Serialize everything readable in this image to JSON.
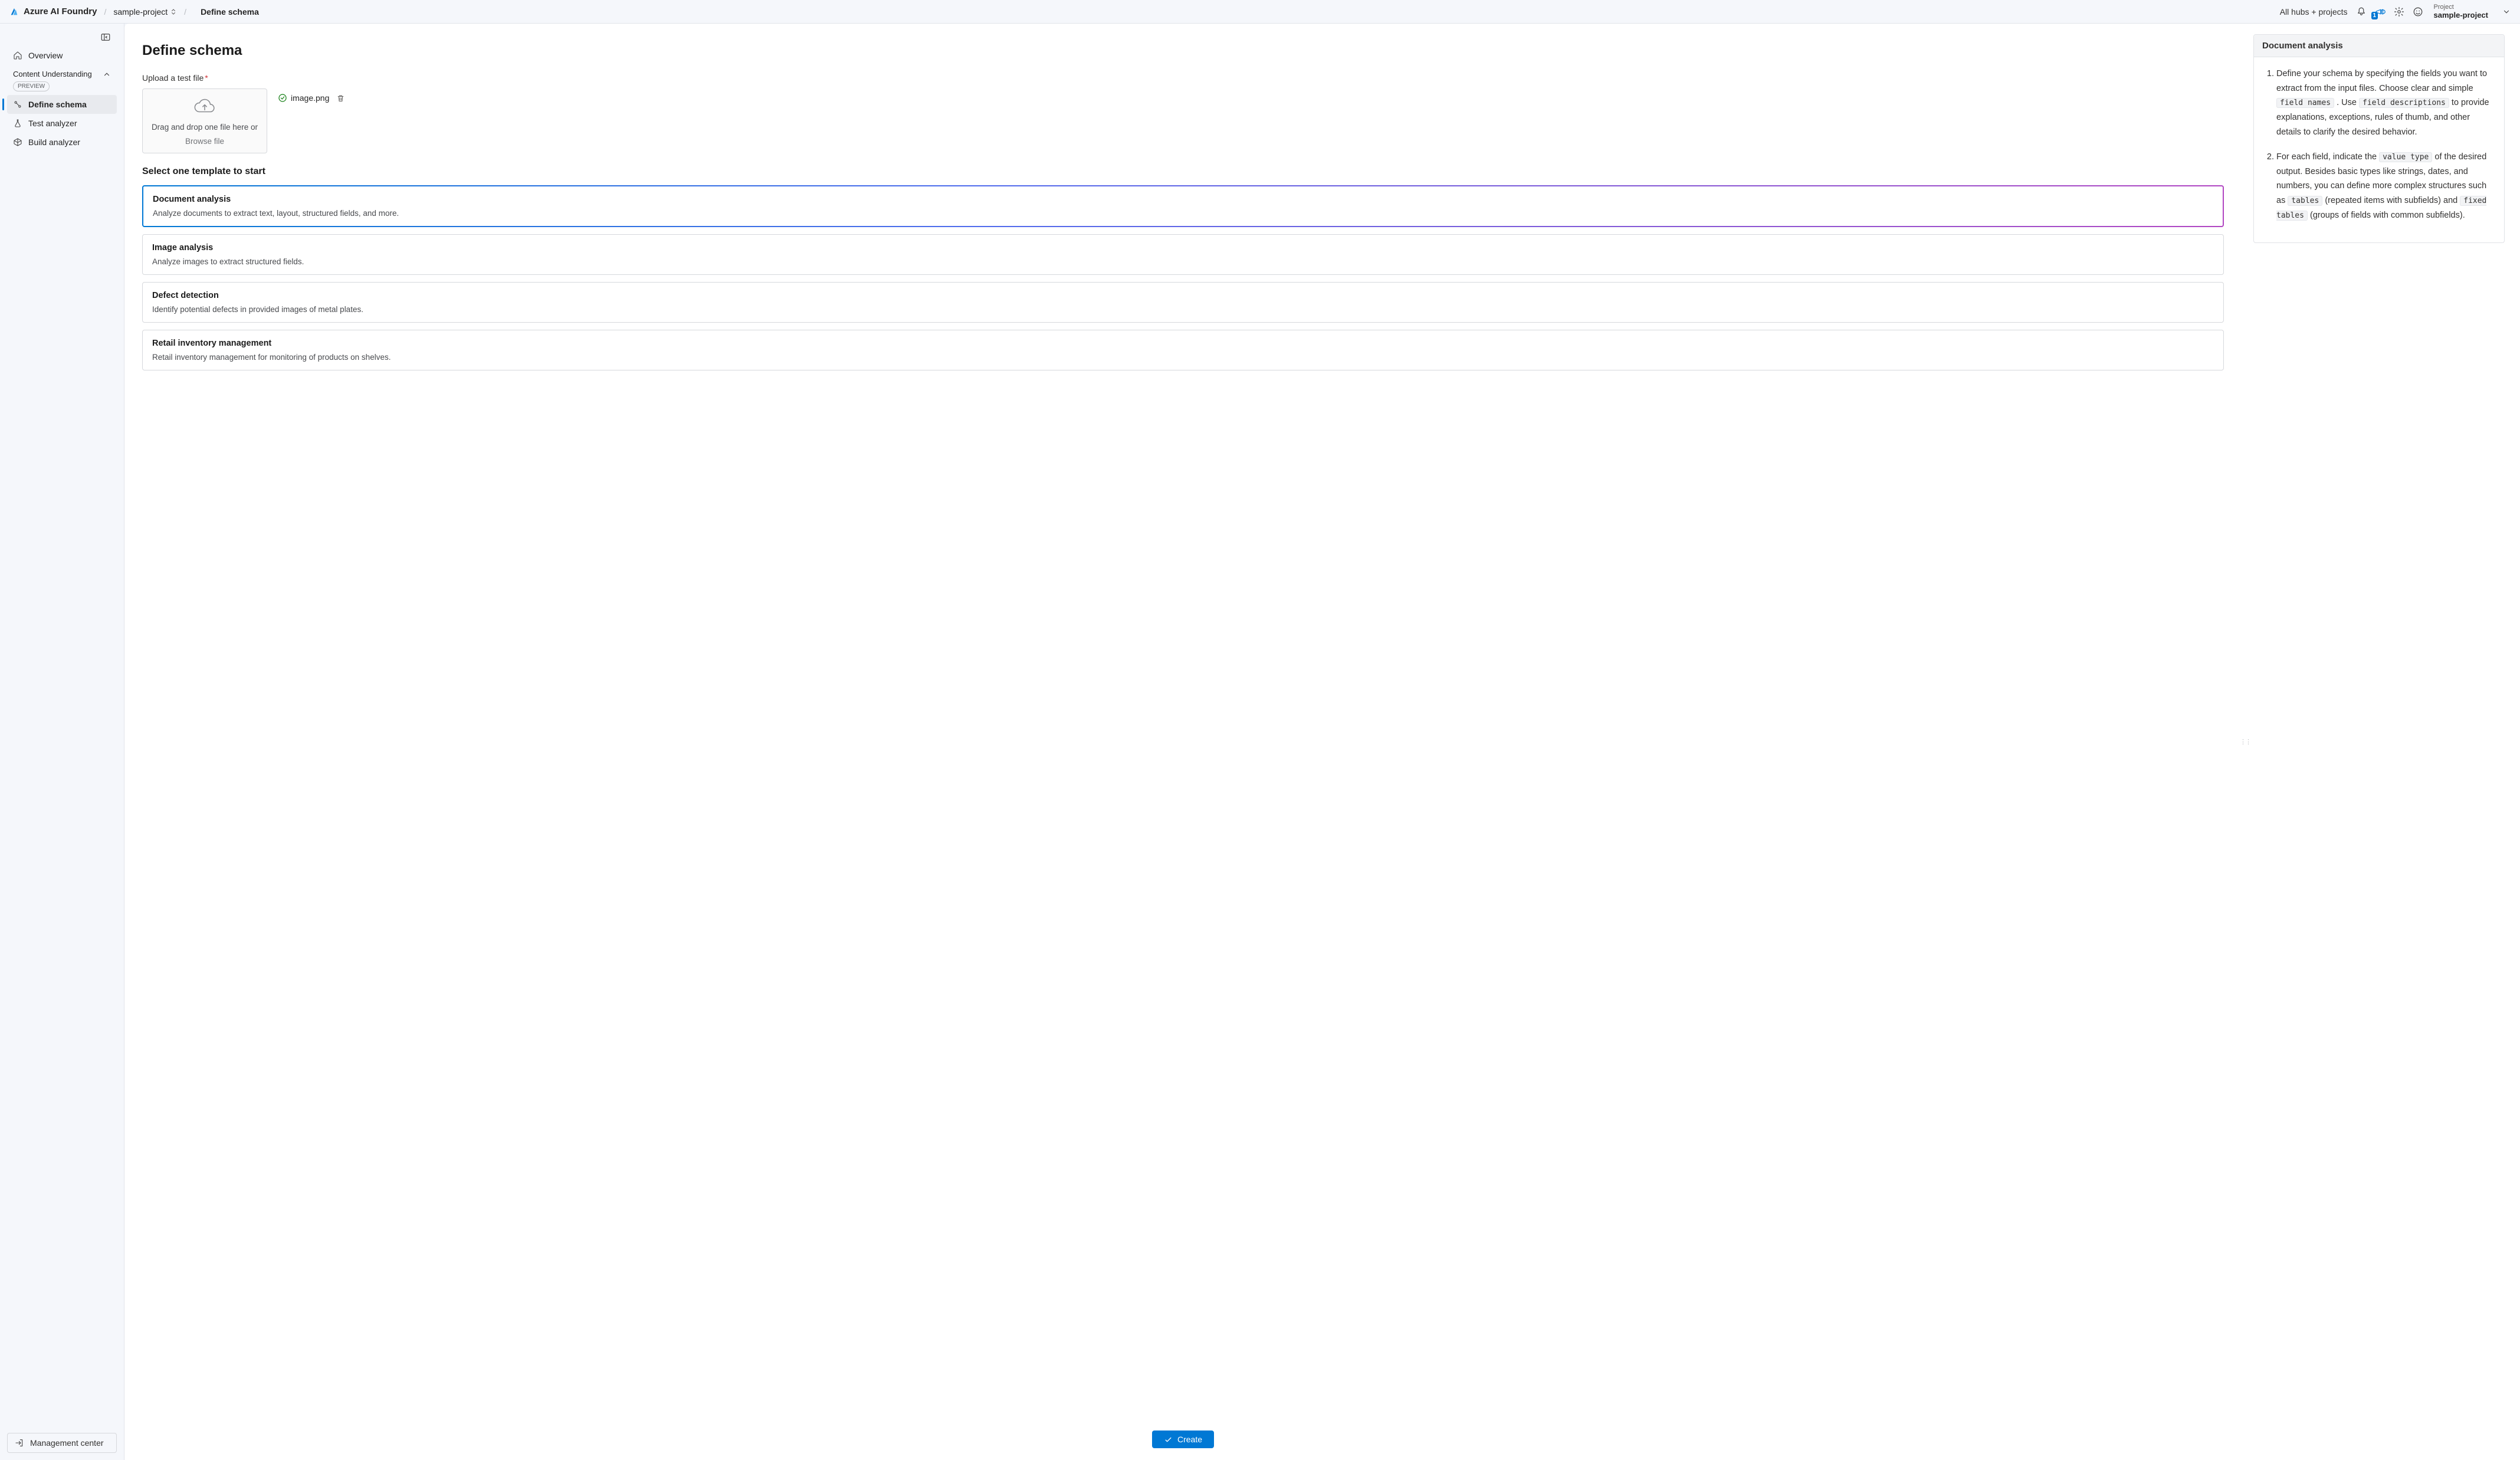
{
  "brand": "Azure AI Foundry",
  "breadcrumb": {
    "project": "sample-project",
    "current": "Define schema"
  },
  "topbar": {
    "hubs_link": "All hubs + projects",
    "announce_badge": "1",
    "project_label": "Project",
    "project_value": "sample-project"
  },
  "sidebar": {
    "overview": "Overview",
    "group_title": "Content Understanding",
    "preview_tag": "PREVIEW",
    "define_schema": "Define schema",
    "test_analyzer": "Test analyzer",
    "build_analyzer": "Build analyzer",
    "mgmt_center": "Management center"
  },
  "page": {
    "title": "Define schema",
    "upload_label": "Upload a test file",
    "drop_line1": "Drag and drop one file here or",
    "drop_line2": "Browse file",
    "uploaded_file": "image.png",
    "templates_title": "Select one template to start",
    "create_btn": "Create"
  },
  "templates": [
    {
      "title": "Document analysis",
      "desc": "Analyze documents to extract text, layout, structured fields, and more.",
      "selected": true
    },
    {
      "title": "Image analysis",
      "desc": "Analyze images to extract structured fields.",
      "selected": false
    },
    {
      "title": "Defect detection",
      "desc": "Identify potential defects in provided images of metal plates.",
      "selected": false
    },
    {
      "title": "Retail inventory management",
      "desc": "Retail inventory management for monitoring of products on shelves.",
      "selected": false
    }
  ],
  "right": {
    "title": "Document analysis",
    "li1_a": "Define your schema by specifying the fields you want to extract from the input files. Choose clear and simple ",
    "li1_code1": "field names",
    "li1_b": ". Use ",
    "li1_code2": "field descriptions",
    "li1_c": " to provide explanations, exceptions, rules of thumb, and other details to clarify the desired behavior.",
    "li2_a": "For each field, indicate the ",
    "li2_code1": "value type",
    "li2_b": " of the desired output. Besides basic types like strings, dates, and numbers, you can define more complex structures such as ",
    "li2_code2": "tables",
    "li2_c": " (repeated items with subfields) and ",
    "li2_code3": "fixed tables",
    "li2_d": " (groups of fields with common subfields)."
  }
}
